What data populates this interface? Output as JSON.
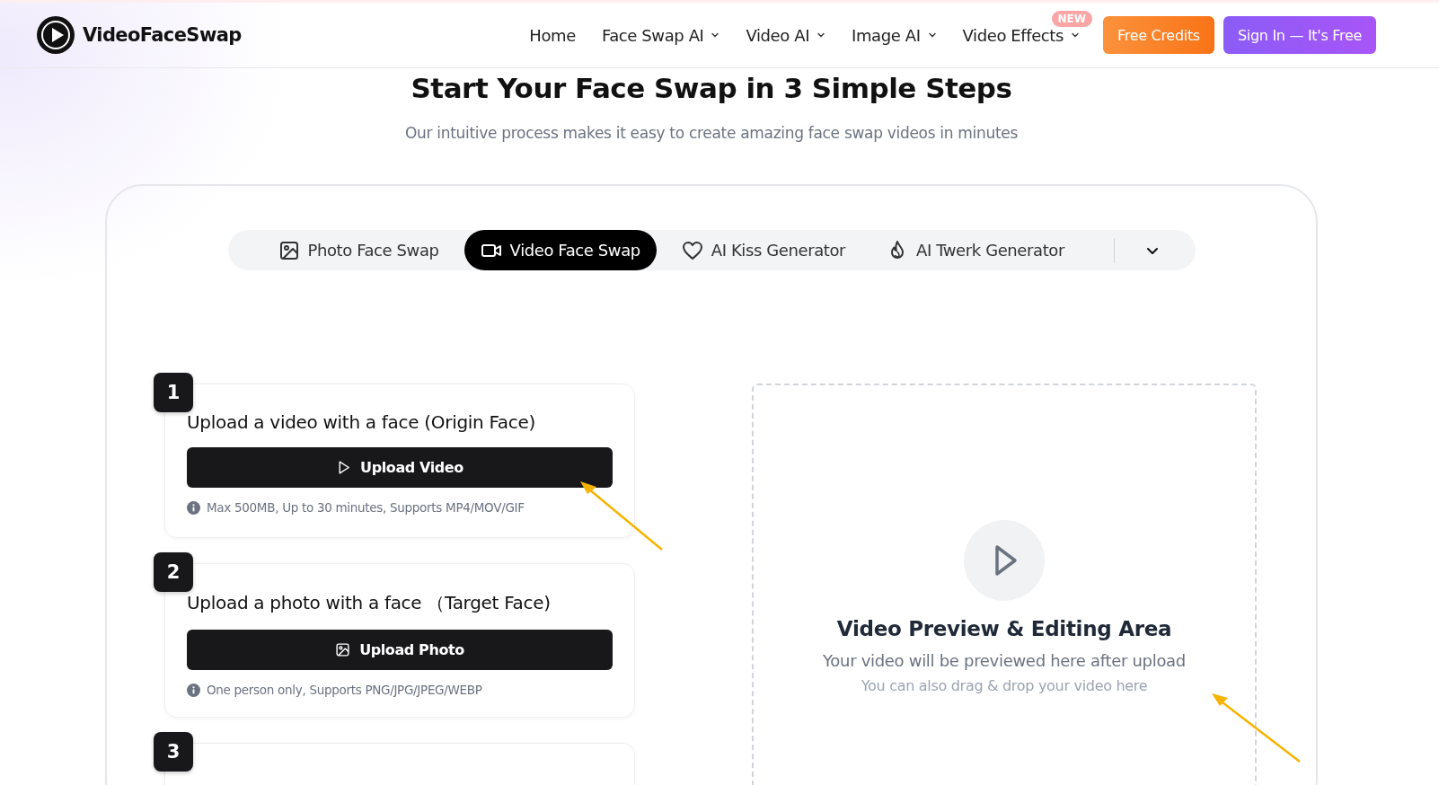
{
  "header": {
    "brand": "VideoFaceSwap",
    "nav": [
      {
        "label": "Home",
        "dropdown": false
      },
      {
        "label": "Face Swap AI",
        "dropdown": true
      },
      {
        "label": "Video AI",
        "dropdown": true
      },
      {
        "label": "Image AI",
        "dropdown": true
      },
      {
        "label": "Video Effects",
        "dropdown": true,
        "badge": "NEW"
      }
    ],
    "buttons": [
      {
        "label": "Free Credits",
        "kind": "orange"
      },
      {
        "label": "Sign In — It's Free",
        "kind": "purple"
      }
    ]
  },
  "hero": {
    "title": "Start Your Face Swap in 3 Simple Steps",
    "subtitle": "Our intuitive process makes it easy to create amazing face swap videos in minutes"
  },
  "tabs": [
    {
      "label": "Photo Face Swap",
      "selected": false
    },
    {
      "label": "Video Face Swap",
      "selected": true
    },
    {
      "label": "AI Kiss Generator",
      "selected": false
    },
    {
      "label": "AI Twerk Generator",
      "selected": false
    }
  ],
  "steps": [
    {
      "number": "1",
      "title": "Upload a video with a face (Origin Face)",
      "button": "Upload Video",
      "note": "Max 500MB, Up to 30 minutes, Supports MP4/MOV/GIF"
    },
    {
      "number": "2",
      "title": "Upload a photo with a face （Target Face)",
      "button": "Upload Photo",
      "note": "One person only, Supports PNG/JPG/JPEG/WEBP"
    },
    {
      "number": "3"
    }
  ],
  "preview": {
    "title": "Video Preview & Editing Area",
    "text": "Your video will be previewed here after upload",
    "hint": "You can also drag & drop your video here"
  }
}
